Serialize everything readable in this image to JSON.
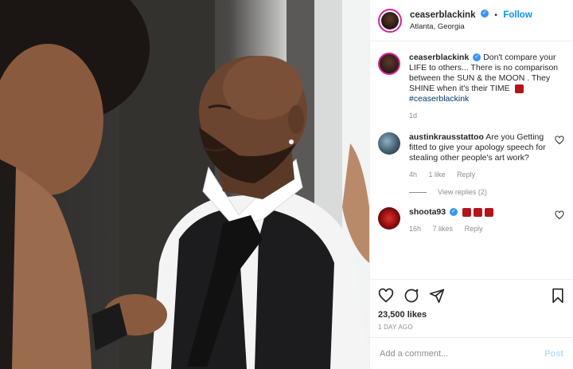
{
  "post": {
    "username": "ceaserblackink",
    "follow_label": "Follow",
    "location": "Atlanta, Georgia",
    "photo_icon": "post-photo"
  },
  "comments": [
    {
      "username": "ceaserblackink",
      "text": "Don't compare your LIFE to others... There is no comparison between the SUN & the MOON . They SHINE when it's their TIME",
      "hashtag": "#ceaserblackink",
      "age": "1d"
    },
    {
      "username": "austinkrausstattoo",
      "text": "Are you Getting fitted to give your apology speech for stealing other people's art work?",
      "age": "4h",
      "likes": "1 like",
      "reply": "Reply",
      "view_replies": "View replies (2)"
    },
    {
      "username": "shoota93",
      "text": "",
      "age": "16h",
      "likes": "7 likes",
      "reply": "Reply"
    }
  ],
  "stats": {
    "likes": "23,500 likes",
    "posted": "1 DAY AGO"
  },
  "add_comment": {
    "placeholder": "Add a comment...",
    "post_label": "Post"
  },
  "colors": {
    "accent": "#0095f6",
    "verified": "#3897f0",
    "post_disabled": "#b2dffc"
  }
}
